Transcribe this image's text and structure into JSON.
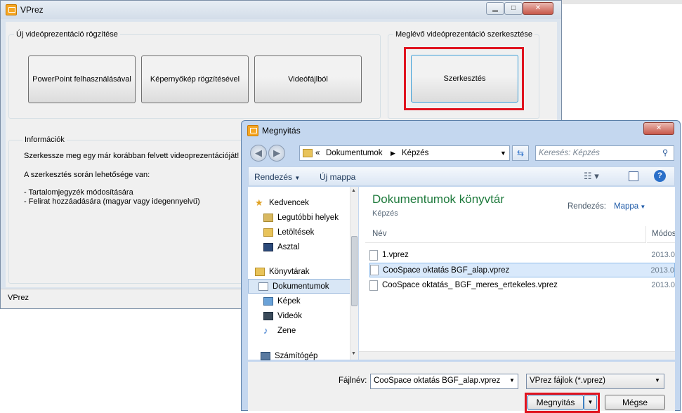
{
  "main_window": {
    "title": "VPrez",
    "new_group_label": "Új videóprezentáció rögzítése",
    "btn_powerpoint": "PowerPoint felhasználásával",
    "btn_screen": "Képernyőkép rögzítésével",
    "btn_video": "Videófájlból",
    "edit_group_label": "Meglévő videóprezentáció szerkesztése",
    "btn_edit": "Szerkesztés",
    "info_group_label": "Információk",
    "info_line1": "Szerkessze meg egy már korábban felvett videoprezentációját!",
    "info_line2": "A szerkesztés során lehetősége van:",
    "info_line3": "- Tartalomjegyzék módosítására",
    "info_line4": "- Felirat hozzáadására (magyar vagy idegennyelvű)",
    "status": "VPrez"
  },
  "dialog": {
    "title": "Megnyitás",
    "path_root": "«",
    "path_1": "Dokumentumok",
    "path_2": "Képzés",
    "search_placeholder": "Keresés: Képzés",
    "organize": "Rendezés",
    "new_folder": "Új mappa",
    "nav": {
      "favorites": "Kedvencek",
      "recent": "Legutóbbi helyek",
      "downloads": "Letöltések",
      "desktop": "Asztal",
      "libraries": "Könyvtárak",
      "documents": "Dokumentumok",
      "pictures": "Képek",
      "videos": "Videók",
      "music": "Zene",
      "computer": "Számítógép"
    },
    "library_title": "Dokumentumok könyvtár",
    "library_sub": "Képzés",
    "arrange_label": "Rendezés:",
    "arrange_value": "Mappa",
    "col_name": "Név",
    "col_modified": "Módos",
    "files": [
      {
        "name": "1.vprez",
        "date": "2013.0"
      },
      {
        "name": "CooSpace oktatás BGF_alap.vprez",
        "date": "2013.0"
      },
      {
        "name": "CooSpace oktatás_ BGF_meres_ertekeles.vprez",
        "date": "2013.0"
      }
    ],
    "filename_label": "Fájlnév:",
    "filename_value": "CooSpace oktatás BGF_alap.vprez",
    "filter_value": "VPrez fájlok (*.vprez)",
    "open_button": "Megnyitás",
    "cancel_button": "Mégse"
  },
  "colors": {
    "highlight_red": "#e0141f",
    "library_title": "#1e7a3c",
    "link_blue": "#1e5aa8"
  }
}
